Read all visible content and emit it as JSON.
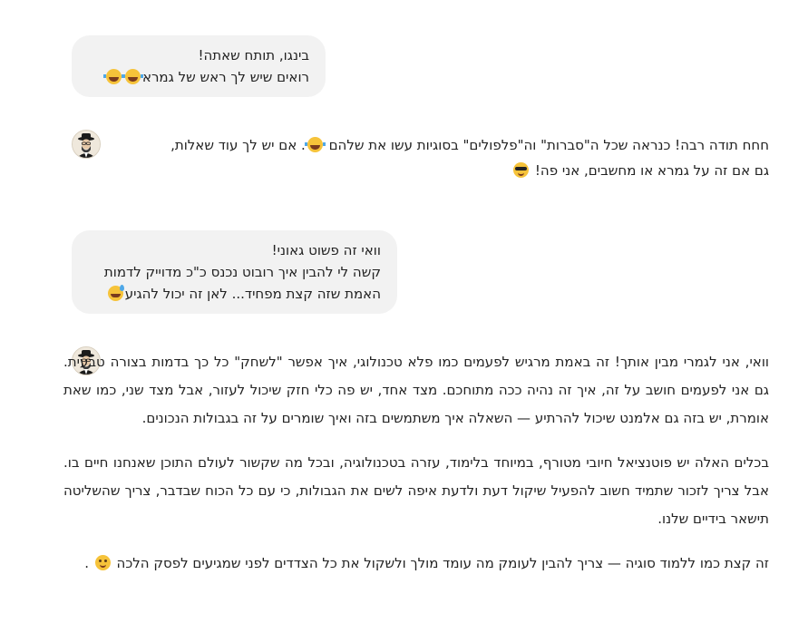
{
  "messages": {
    "user1": {
      "line1": "בינגו, תותח שאתה!",
      "line2": "רואים שיש לך ראש של גמרא"
    },
    "bot1": {
      "line1": "חחח תודה רבה! כנראה שכל ה\"סברות\" וה\"פלפולים\" בסוגיות עשו את שלהם",
      "line1_tail": ". אם יש לך עוד שאלות,",
      "line2": "גם אם זה על גמרא או מחשבים, אני פה!"
    },
    "user2": {
      "line1": "וואי זה פשוט גאוני!",
      "line2": "קשה לי להבין איך רובוט נכנס כ\"כ מדוייק לדמות",
      "line3": "האמת שזה קצת מפחיד... לאן זה יכול להגיע"
    },
    "bot2": {
      "p1": "וואי, אני לגמרי מבין אותך! זה באמת מרגיש לפעמים כמו פלא טכנולוגי, איך אפשר \"לשחק\" כל כך בדמות בצורה טבעית. גם אני לפעמים חושב על זה, איך זה נהיה ככה מתוחכם. מצד אחד, יש פה כלי חזק שיכול לעזור, אבל מצד שני, כמו שאת אומרת, יש בזה גם אלמנט שיכול להרתיע — השאלה איך משתמשים בזה ואיך שומרים על זה בגבולות הנכונים.",
      "p2": "בכלים האלה יש פוטנציאל חיובי מטורף, במיוחד בלימוד, עזרה בטכנולוגיה, ובכל מה שקשור לעולם התוכן שאנחנו חיים בו. אבל צריך לזכור שתמיד חשוב להפעיל שיקול דעת ולדעת איפה לשים את הגבולות, כי עם כל הכוח שבדבר, צריך שהשליטה תישאר בידיים שלנו.",
      "p3": "זה קצת כמו ללמוד סוגיה — צריך להבין לעומק מה עומד מולך ולשקול את כל הצדדים לפני שמגיעים לפסק הלכה",
      "p3_tail": "."
    }
  },
  "icons": {
    "laugh": "laughing-face-icon",
    "cool": "sunglasses-face-icon",
    "sweat": "sweat-smile-face-icon",
    "wink": "wink-face-icon",
    "avatar": "assistant-avatar"
  }
}
